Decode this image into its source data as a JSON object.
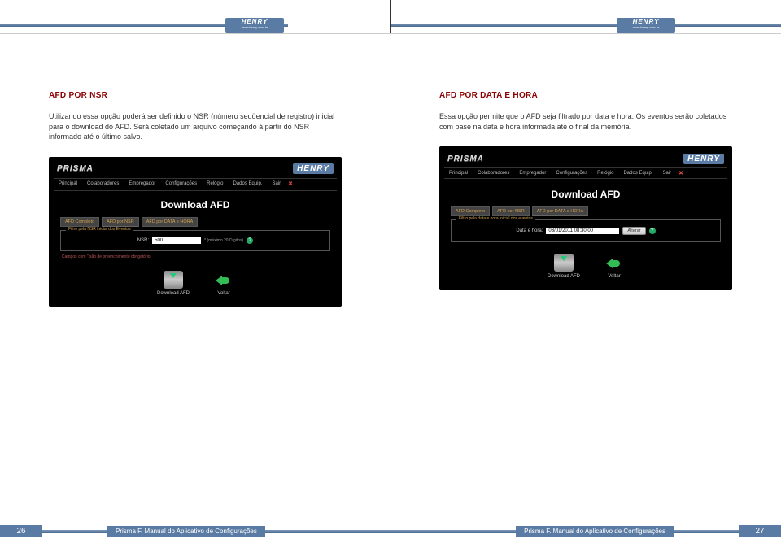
{
  "header_logo": {
    "brand": "HENRY",
    "url": "www.henry.com.br"
  },
  "left": {
    "heading": "AFD POR NSR",
    "body": "Utilizando essa opção poderá ser definido o NSR (número seqüencial de registro) inicial para o download do AFD. Será coletado um arquivo começando à partir do NSR informado até o último salvo."
  },
  "right": {
    "heading": "AFD POR DATA E HORA",
    "body": "Essa opção permite que o AFD seja filtrado por data e hora. Os eventos serão coletados com base na data e hora informada até o final da memória."
  },
  "app": {
    "brand_left": "PRISMA",
    "brand_right": "HENRY",
    "menu": [
      "Principal",
      "Colaboradores",
      "Empregador",
      "Configurações",
      "Relógio",
      "Dados Equip.",
      "Sair"
    ],
    "title": "Download AFD",
    "tabs": [
      "AFD Completo",
      "AFD por NSR",
      "AFD por DATA e HORA"
    ],
    "active_tab_left": 1,
    "active_tab_right": 2,
    "fs_left": {
      "legend": "Filtro pela NSR inicial dos Eventos",
      "label": "NSR:",
      "value": "500",
      "hint": "* (máximo 20 Dígitos)"
    },
    "note_left": "Campos com \" são de preenchimento obrigatório",
    "fs_right": {
      "legend": "Filtro pela data e hora inicial dos eventos",
      "label": "Data e hora:",
      "value": "03/01/2011 08:30:00",
      "button": "Alterar"
    },
    "actions": {
      "download": "Download AFD",
      "back": "Voltar"
    }
  },
  "footer": {
    "title": "Prisma F. Manual do Aplicativo de Configurações",
    "page_left": "26",
    "page_right": "27"
  }
}
